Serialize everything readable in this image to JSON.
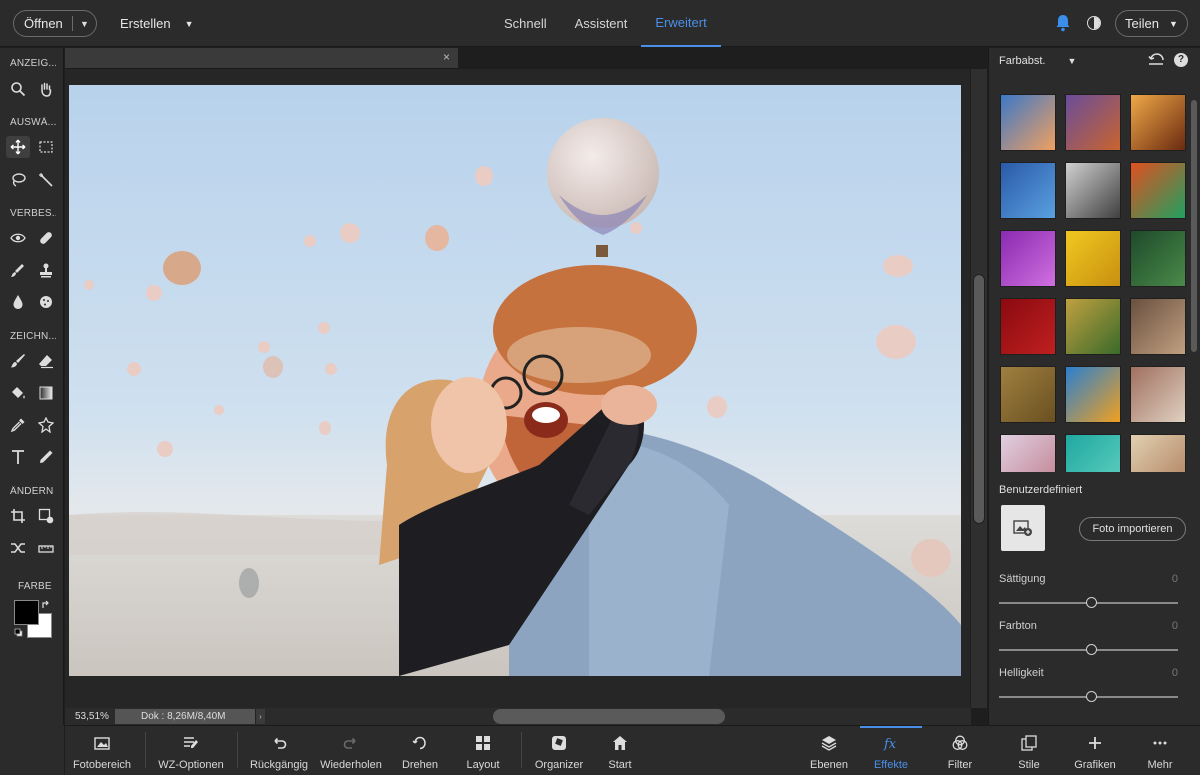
{
  "topbar": {
    "open_label": "Öffnen",
    "create_label": "Erstellen",
    "mode_tabs": [
      {
        "label": "Schnell"
      },
      {
        "label": "Assistent"
      },
      {
        "label": "Erweitert"
      }
    ],
    "active_mode": "Erweitert",
    "share_label": "Teilen",
    "icons": [
      "bell-icon",
      "theme-toggle-icon"
    ]
  },
  "tools": {
    "sections": {
      "view": "ANZEIG...",
      "select": "AUSWÄ...",
      "enhance": "VERBES...",
      "draw": "ZEICHN...",
      "modify": "ÄNDERN",
      "color": "FARBE"
    },
    "active_tool": "move-tool"
  },
  "document": {
    "zoom": "53,51%",
    "doc_size": "Dok : 8,26M/8,40M"
  },
  "right_panel": {
    "title": "Farbabst.",
    "custom_label": "Benutzerdefiniert",
    "import_label": "Foto importieren",
    "sliders": [
      {
        "label": "Sättigung",
        "value": "0"
      },
      {
        "label": "Farbton",
        "value": "0"
      },
      {
        "label": "Helligkeit",
        "value": "0"
      }
    ],
    "thumbnail_colors": [
      [
        "#3c78c8",
        "#f0a060"
      ],
      [
        "#6a4d9a",
        "#c8642e"
      ],
      [
        "#f0a848",
        "#6a2a10"
      ],
      [
        "#2a5aa8",
        "#5aa0e0"
      ],
      [
        "#d0d0d0",
        "#404040"
      ],
      [
        "#e05020",
        "#20a060"
      ],
      [
        "#8a2ab0",
        "#d070e0"
      ],
      [
        "#f0c820",
        "#c89010"
      ],
      [
        "#1e4a2a",
        "#4a8a4a"
      ],
      [
        "#8a0a10",
        "#c02020"
      ],
      [
        "#c0a040",
        "#3a6a2a"
      ],
      [
        "#6a5040",
        "#c0a080"
      ],
      [
        "#a08040",
        "#6a5020"
      ],
      [
        "#2a80d0",
        "#f0a020"
      ],
      [
        "#a07060",
        "#e0d0c0"
      ],
      [
        "#e0d0e0",
        "#c08090"
      ],
      [
        "#20a8a0",
        "#60d0c0"
      ],
      [
        "#e0d0b0",
        "#b08060"
      ]
    ]
  },
  "bottombar": {
    "items": [
      {
        "label": "Fotobereich"
      },
      {
        "label": "WZ-Optionen"
      },
      {
        "label": "Rückgängig"
      },
      {
        "label": "Wiederholen"
      },
      {
        "label": "Drehen"
      },
      {
        "label": "Layout"
      },
      {
        "label": "Organizer"
      },
      {
        "label": "Start"
      },
      {
        "label": "Ebenen"
      },
      {
        "label": "Effekte"
      },
      {
        "label": "Filter"
      },
      {
        "label": "Stile"
      },
      {
        "label": "Grafiken"
      },
      {
        "label": "Mehr"
      }
    ],
    "active": "Effekte"
  }
}
